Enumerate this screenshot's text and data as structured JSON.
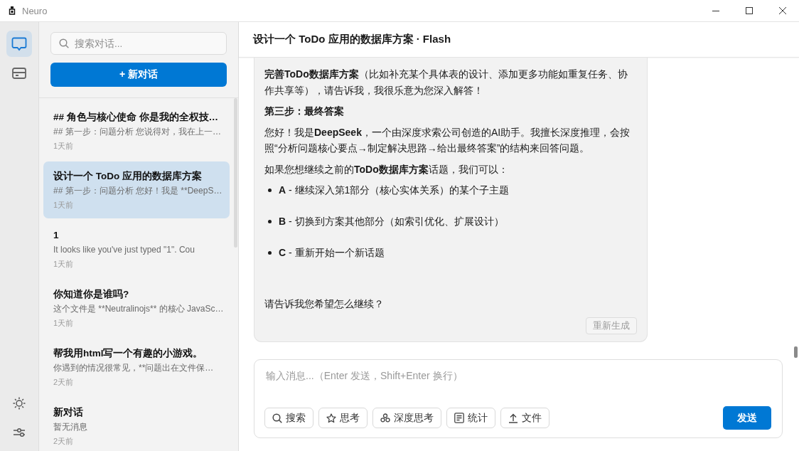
{
  "window": {
    "title": "Neuro"
  },
  "rail": {
    "top": [
      {
        "selected": true
      },
      {
        "selected": false
      }
    ]
  },
  "sidebar": {
    "search": {
      "placeholder": "搜索对话..."
    },
    "new_button": "+ 新对话",
    "conversations": [
      {
        "title": "## 角色与核心使命 你是我的全权技…",
        "preview": "## 第一步：问题分析 您说得对，我在上一…",
        "time": "1天前",
        "selected": false
      },
      {
        "title": "设计一个 ToDo 应用的数据库方案",
        "preview": "## 第一步：问题分析 您好！我是 **DeepS…",
        "time": "1天前",
        "selected": true
      },
      {
        "title": "1",
        "preview": "It looks like you've just typed \"1\". Cou",
        "time": "1天前",
        "selected": false
      },
      {
        "title": "你知道你是谁吗?",
        "preview": "这个文件是 **Neutralinojs** 的核心 JavaSc…",
        "time": "1天前",
        "selected": false
      },
      {
        "title": "帮我用html写一个有趣的小游戏。",
        "preview": "你遇到的情况很常见，**问题出在文件保…",
        "time": "2天前",
        "selected": false
      },
      {
        "title": "新对话",
        "preview": "暂无消息",
        "time": "2天前",
        "selected": false
      }
    ]
  },
  "chat": {
    "title": "设计一个 ToDo 应用的数据库方案 · Flash",
    "message": {
      "blocks": [
        {
          "kind": "paragraph",
          "text": "**完善ToDo数据库方案**（比如补充某个具体表的设计、添加更多功能如重复任务、协作共享等），请告诉我，我很乐意为您深入解答！"
        },
        {
          "kind": "heading",
          "text": "第三步：最终答案"
        },
        {
          "kind": "paragraph",
          "text": "您好！我是**DeepSeek**，一个由深度求索公司创造的AI助手。我擅长深度推理，会按照“分析问题核心要点→制定解决思路→给出最终答案”的结构来回答问题。"
        },
        {
          "kind": "paragraph",
          "text": "如果您想继续之前的**ToDo数据库方案**话题，我们可以："
        },
        {
          "kind": "list",
          "items": [
            "**A** - 继续深入第1部分（核心实体关系）的某个子主题",
            "**B** - 切换到方案其他部分（如索引优化、扩展设计）",
            "**C** - 重新开始一个新话题"
          ]
        },
        {
          "kind": "paragraph",
          "text": "请告诉我您希望怎么继续？"
        }
      ],
      "regenerate_button": "重新生成"
    },
    "composer": {
      "placeholder": "输入消息...（Enter 发送，Shift+Enter 换行）",
      "tools": [
        "搜索",
        "思考",
        "深度思考",
        "统计",
        "文件"
      ],
      "send_button": "发送"
    }
  }
}
